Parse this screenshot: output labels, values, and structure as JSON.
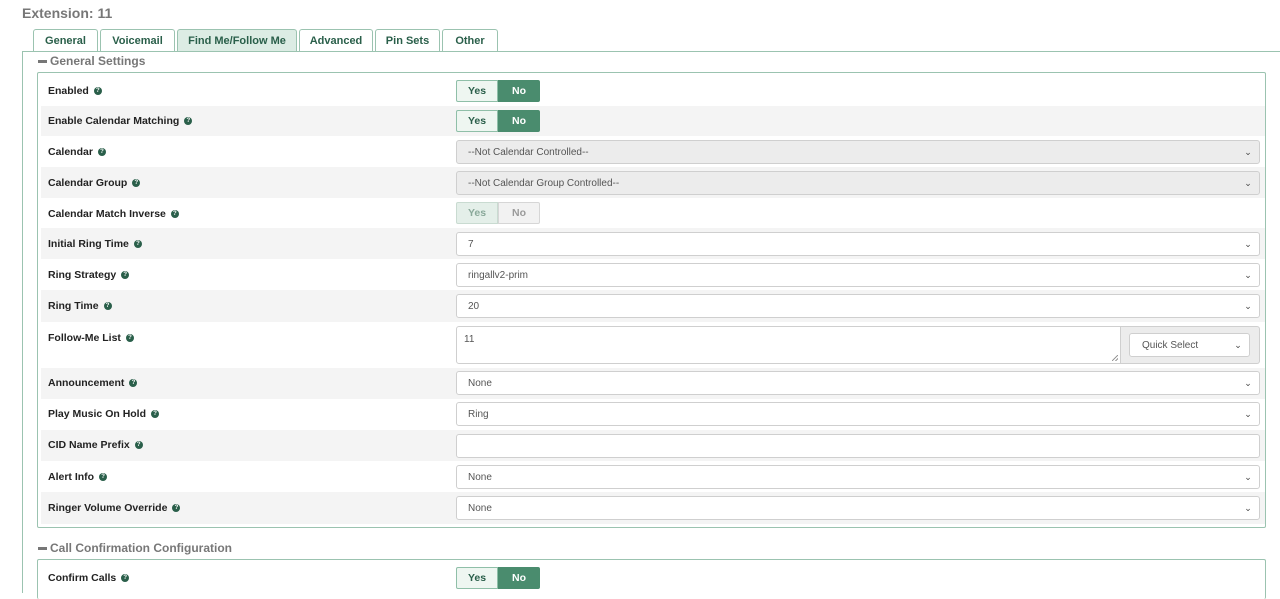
{
  "page_title": "Extension: 11",
  "tabs": [
    {
      "label": "General"
    },
    {
      "label": "Voicemail"
    },
    {
      "label": "Find Me/Follow Me"
    },
    {
      "label": "Advanced"
    },
    {
      "label": "Pin Sets"
    },
    {
      "label": "Other"
    }
  ],
  "active_tab": "Find Me/Follow Me",
  "sections": {
    "general": {
      "title": "General Settings"
    },
    "call_confirmation": {
      "title": "Call Confirmation Configuration"
    }
  },
  "toggle_labels": {
    "yes": "Yes",
    "no": "No"
  },
  "fields": {
    "enabled": {
      "label": "Enabled",
      "value": "No"
    },
    "enable_calendar_matching": {
      "label": "Enable Calendar Matching",
      "value": "No"
    },
    "calendar": {
      "label": "Calendar",
      "value": "--Not Calendar Controlled--"
    },
    "calendar_group": {
      "label": "Calendar Group",
      "value": "--Not Calendar Group Controlled--"
    },
    "calendar_match_inverse": {
      "label": "Calendar Match Inverse",
      "value": "No"
    },
    "initial_ring_time": {
      "label": "Initial Ring Time",
      "value": "7"
    },
    "ring_strategy": {
      "label": "Ring Strategy",
      "value": "ringallv2-prim"
    },
    "ring_time": {
      "label": "Ring Time",
      "value": "20"
    },
    "follow_me_list": {
      "label": "Follow-Me List",
      "value": "11",
      "quick_select": "Quick Select"
    },
    "announcement": {
      "label": "Announcement",
      "value": "None"
    },
    "play_music_on_hold": {
      "label": "Play Music On Hold",
      "value": "Ring"
    },
    "cid_name_prefix": {
      "label": "CID Name Prefix",
      "value": ""
    },
    "alert_info": {
      "label": "Alert Info",
      "value": "None"
    },
    "ringer_volume_override": {
      "label": "Ringer Volume Override",
      "value": "None"
    },
    "confirm_calls": {
      "label": "Confirm Calls",
      "value": "No"
    }
  },
  "colors": {
    "accent": "#4a8c6e",
    "tab_border": "#9bc3b0",
    "active_tab_bg": "#dcece4"
  }
}
